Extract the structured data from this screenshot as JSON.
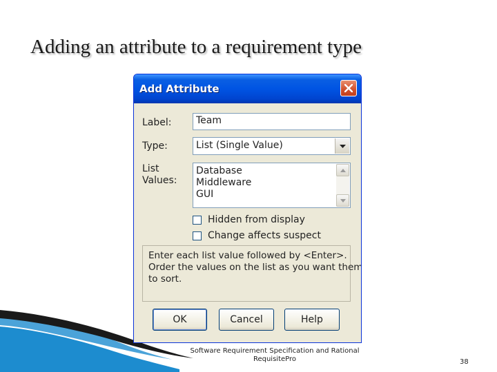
{
  "slide": {
    "title": "Adding an attribute to a requirement type",
    "footer": [
      "Software Requirement Specification and Rational",
      "RequisitePro"
    ],
    "page_number": "38"
  },
  "dialog": {
    "title": "Add Attribute",
    "close_icon": "close-icon",
    "label_field": {
      "label": "Label:",
      "value": "Team"
    },
    "type_field": {
      "label": "Type:",
      "value": "List (Single Value)"
    },
    "list_values": {
      "label_line1": "List",
      "label_line2": "Values:",
      "items": [
        "Database",
        "Middleware",
        "GUI"
      ]
    },
    "checkboxes": [
      {
        "label": "Hidden from display",
        "checked": false
      },
      {
        "label": "Change affects suspect",
        "checked": false
      }
    ],
    "hint": [
      "Enter each list value followed by <Enter>.",
      "Order the values on the list as you want them",
      "to sort."
    ],
    "buttons": {
      "ok": "OK",
      "cancel": "Cancel",
      "help": "Help"
    }
  },
  "colors": {
    "titlebar": "#0054e3",
    "dialog_bg": "#ece9d8",
    "close_button": "#d0502d",
    "swoosh_dark": "#1a1a1a",
    "swoosh_blue": "#1d8ccf"
  }
}
